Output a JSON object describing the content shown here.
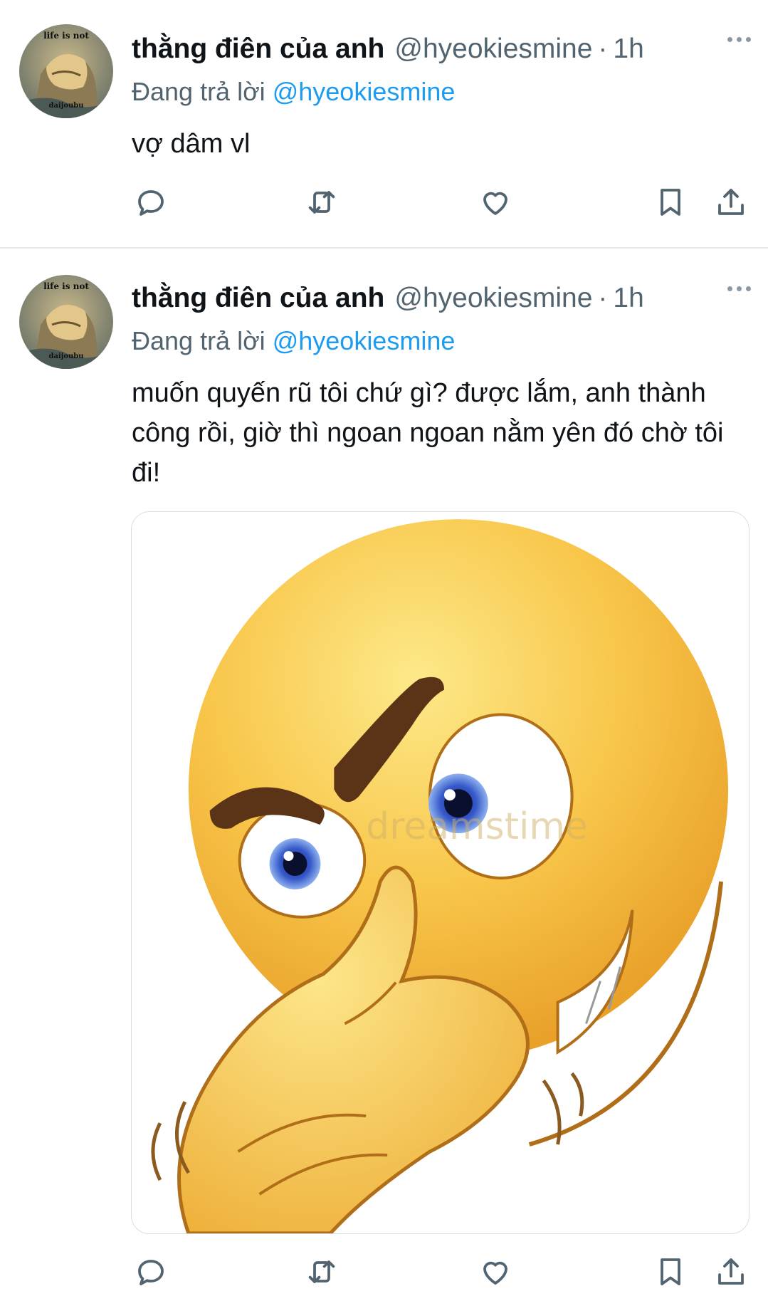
{
  "tweets": [
    {
      "avatar_caption_top": "life is not",
      "avatar_caption_bottom": "daijoubu",
      "display_name": "thằng điên của anh",
      "handle": "@hyeokiesmine",
      "separator": "·",
      "time": "1h",
      "replying_prefix": "Đang trả lời",
      "replying_to": "@hyeokiesmine",
      "text": "vợ dâm vl"
    },
    {
      "avatar_caption_top": "life is not",
      "avatar_caption_bottom": "daijoubu",
      "display_name": "thằng điên của anh",
      "handle": "@hyeokiesmine",
      "separator": "·",
      "time": "1h",
      "replying_prefix": "Đang trả lời",
      "replying_to": "@hyeokiesmine",
      "text": "muốn quyến rũ tôi chứ gì? được lắm, anh thành công rồi, giờ thì ngoan ngoan nằm yên đó chờ tôi đi!",
      "media_watermark": "dreamstime"
    }
  ],
  "icons": {
    "reply": "reply-icon",
    "retweet": "retweet-icon",
    "like": "heart-icon",
    "bookmark": "bookmark-icon",
    "share": "share-icon",
    "more": "more-icon"
  },
  "colors": {
    "text": "#0f1419",
    "secondary": "#536471",
    "accent": "#1d9bf0",
    "divider": "#e6e9eb"
  }
}
